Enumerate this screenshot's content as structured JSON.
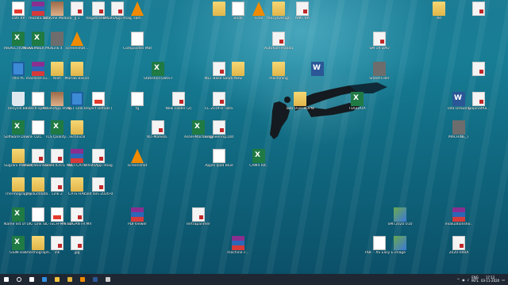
{
  "desktop": {
    "icons": [
      {
        "label": "cats RP",
        "type": "pdf"
      },
      {
        "label": "mozilla.txt",
        "type": "rar"
      },
      {
        "label": "TataOne Modular O..",
        "type": "photo"
      },
      {
        "label": "Jj 1",
        "type": "doc"
      },
      {
        "label": "Registration...",
        "type": "doc"
      },
      {
        "label": "WhatsApp Image 2020-",
        "type": "doc"
      },
      {
        "label": "sam",
        "type": "vlc"
      },
      {
        "label": "",
        "type": "folder"
      },
      {
        "label": "Book",
        "type": "file"
      },
      {
        "label": "Final",
        "type": "vlc"
      },
      {
        "label": "fancy/Design",
        "type": "folder"
      },
      {
        "label": "NMC 8A",
        "type": "doc"
      },
      {
        "label": "Ad",
        "type": "folder"
      },
      {
        "label": "",
        "type": "doc"
      },
      {
        "label": "INSPECTION SHEET - FU...",
        "type": "excel"
      },
      {
        "label": "NOVEMBER MONTH 2020 -..",
        "type": "excel"
      },
      {
        "label": "Link 4",
        "type": "exe"
      },
      {
        "label": "screenshot...",
        "type": "vlc"
      },
      {
        "label": "Composites Materials",
        "type": "file"
      },
      {
        "label": "SM 19 DAO",
        "type": "doc"
      },
      {
        "label": "Autofuel-mandar-Fin...",
        "type": "doc"
      },
      {
        "label": "This PC",
        "type": "pc"
      },
      {
        "label": "machine-cu...",
        "type": "rar"
      },
      {
        "label": "Nish",
        "type": "folder"
      },
      {
        "label": "Marlab Basics",
        "type": "folder"
      },
      {
        "label": "Statistics-Data-A...",
        "type": "excel"
      },
      {
        "label": "NET Base Solution.",
        "type": "doc"
      },
      {
        "label": "New",
        "type": "folder"
      },
      {
        "label": "machining",
        "type": "folder"
      },
      {
        "label": "",
        "type": "word"
      },
      {
        "label": "Sheet-Filler",
        "type": "exe"
      },
      {
        "label": "",
        "type": "doc"
      },
      {
        "label": "Recycle Bin",
        "type": "bin"
      },
      {
        "label": "Litech-spen...",
        "type": "file"
      },
      {
        "label": "WhatsApp Image 2020-",
        "type": "photo"
      },
      {
        "label": "NET Link 2",
        "type": "pc"
      },
      {
        "label": "Project Details (S...",
        "type": "pdf"
      },
      {
        "label": "fg",
        "type": "file"
      },
      {
        "label": "New Folder (2)",
        "type": "doc"
      },
      {
        "label": "CL 2019-8 -Tata-wh...",
        "type": "doc"
      },
      {
        "label": "Tata Ovel-BOPNS..",
        "type": "folder"
      },
      {
        "label": "TDGDATA",
        "type": "excel"
      },
      {
        "label": "Tata Drawing",
        "type": "word"
      },
      {
        "label": "Gopinatha..",
        "type": "doc"
      },
      {
        "label": "Software Download",
        "type": "excel"
      },
      {
        "label": "O2C",
        "type": "file"
      },
      {
        "label": "TCS Quality...",
        "type": "excel"
      },
      {
        "label": "Technical",
        "type": "folder"
      },
      {
        "label": "KIT-Mahela..",
        "type": "doc"
      },
      {
        "label": "Assel-Machining",
        "type": "excel"
      },
      {
        "label": "Engineering Data Expo..",
        "type": "doc"
      },
      {
        "label": "MACHINE_T",
        "type": "exe"
      },
      {
        "label": "Sugrani Pathway Ph..",
        "type": "folder"
      },
      {
        "label": "illustration Fallen 88.",
        "type": "doc"
      },
      {
        "label": "CERTIFICATE NOMOGRAM",
        "type": "doc"
      },
      {
        "label": "NET.CATS",
        "type": "rar"
      },
      {
        "label": "WhatsApp Image 2020-",
        "type": "doc"
      },
      {
        "label": "screenshot",
        "type": "vlc"
      },
      {
        "label": "Apple Ipad Blue",
        "type": "file"
      },
      {
        "label": "CAM4 Rit..",
        "type": "excel"
      },
      {
        "label": "Thermography",
        "type": "folder"
      },
      {
        "label": "productdata..",
        "type": "folder"
      },
      {
        "label": "Link 2",
        "type": "doc"
      },
      {
        "label": "CATS HAL",
        "type": "folder"
      },
      {
        "label": "cold lani 2020-01",
        "type": "doc"
      },
      {
        "label": "Name list of UIGB PG...",
        "type": "excel"
      },
      {
        "label": "Link",
        "type": "file"
      },
      {
        "label": "SIL-TECH-M STUDENTS...",
        "type": "pdf"
      },
      {
        "label": "AI SUGANTH MICROSOFT..",
        "type": "doc"
      },
      {
        "label": "PDFViewer",
        "type": "rar"
      },
      {
        "label": "Iertrapanmer",
        "type": "doc"
      },
      {
        "label": "SMT2020 010",
        "type": "img"
      },
      {
        "label": "evaluationsho..",
        "type": "rar"
      },
      {
        "label": "GSIN-solo",
        "type": "excel"
      },
      {
        "label": "Thermograph..",
        "type": "folder"
      },
      {
        "label": "ink",
        "type": "doc"
      },
      {
        "label": "jpg",
        "type": "doc"
      },
      {
        "label": "machine c...",
        "type": "rar"
      },
      {
        "label": "PDF - XS Easy Engine..",
        "type": "file"
      },
      {
        "label": "image",
        "type": "img"
      },
      {
        "label": "2020-000A",
        "type": "doc"
      }
    ]
  },
  "taskbar": {
    "buttons": [
      {
        "name": "start-button",
        "color": "#ffffff"
      },
      {
        "name": "search-button",
        "color": "#ffffff"
      },
      {
        "name": "task-view-button",
        "color": "#ffffff"
      },
      {
        "name": "edge-button",
        "color": "#2f8fe0"
      },
      {
        "name": "explorer-button",
        "color": "#f3c33d"
      },
      {
        "name": "chrome-button",
        "color": "#e3b53b"
      },
      {
        "name": "vlc-button",
        "color": "#f08a00"
      },
      {
        "name": "word-button",
        "color": "#2b5797"
      },
      {
        "name": "app-button",
        "color": "#cccccc"
      }
    ],
    "lang_top": "ENG",
    "lang_bottom": "INTL",
    "time": "17:12",
    "date": "03-11-2020"
  }
}
